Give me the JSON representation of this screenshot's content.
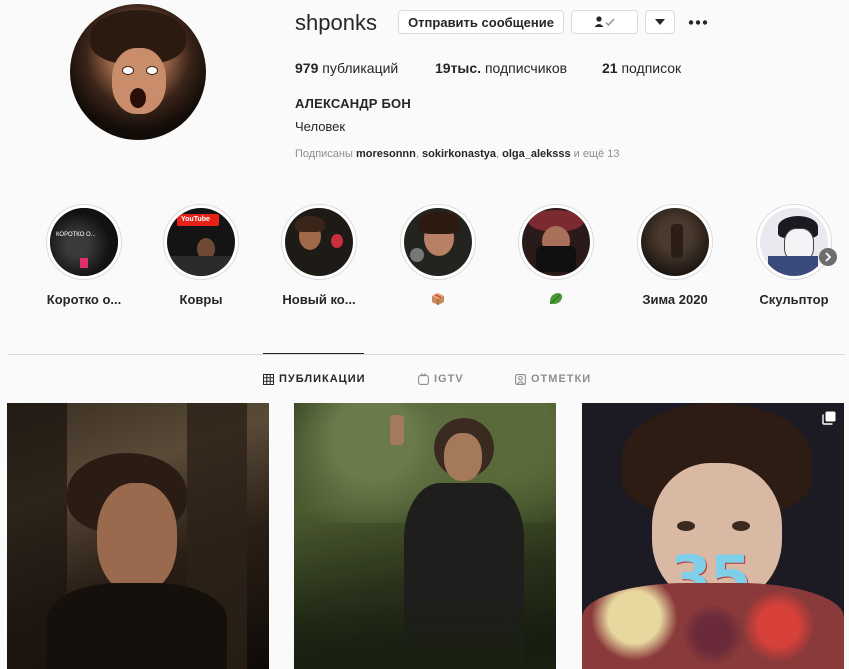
{
  "profile": {
    "username": "shponks",
    "message_button": "Отправить сообщение",
    "more_label": "•••",
    "stats": {
      "posts_count": "979",
      "posts_label": " публикаций",
      "followers_count": "19тыс.",
      "followers_label": " подписчиков",
      "following_count": "21",
      "following_label": " подписок"
    },
    "full_name": "АЛЕКСАНДР БОН",
    "bio": "Человек",
    "followed_by": {
      "prefix": "Подписаны ",
      "users": [
        "moresonnn",
        "sokirkonastya",
        "olga_aleksss"
      ],
      "sep": ", ",
      "suffix": " и ещё 13"
    }
  },
  "highlights": [
    {
      "label": "Коротко о...",
      "thumb_text": "КОРОТКО О..."
    },
    {
      "label": "Ковры",
      "thumb_text": "YouTube"
    },
    {
      "label": "Новый ко..."
    },
    {
      "label": "",
      "emoji_icon": "package-icon"
    },
    {
      "label": "",
      "emoji_icon": "leaf-icon"
    },
    {
      "label": "Зима 2020"
    },
    {
      "label": "Скульптор"
    }
  ],
  "tabs": [
    {
      "label": "ПУБЛИКАЦИИ",
      "icon": "grid-icon",
      "active": true
    },
    {
      "label": "IGTV",
      "icon": "igtv-icon",
      "active": false
    },
    {
      "label": "ОТМЕТКИ",
      "icon": "tagged-icon",
      "active": false
    }
  ],
  "posts": [
    {
      "kind": "photo"
    },
    {
      "kind": "photo"
    },
    {
      "kind": "carousel",
      "cake_number": "35"
    }
  ],
  "colors": {
    "background": "#fafafa",
    "border": "#dbdbdb",
    "text": "#262626",
    "muted": "#8e8e8e"
  }
}
